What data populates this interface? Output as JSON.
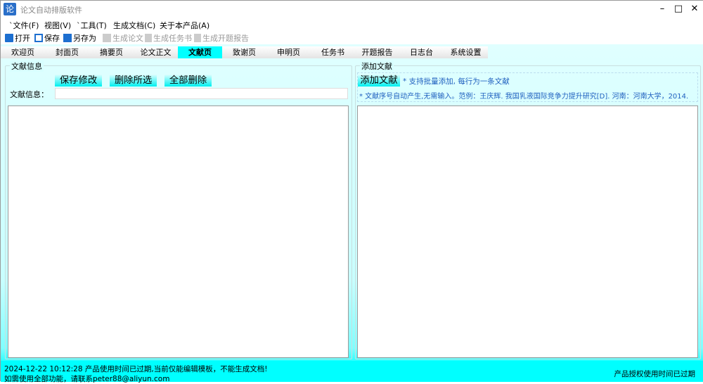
{
  "window": {
    "title": "论文自动排版软件",
    "app_icon": "论"
  },
  "menu": [
    "`文件(F)",
    "视图(V)",
    "`工具(T)",
    "生成文档(C)",
    "关于本产品(A)"
  ],
  "toolbar": [
    {
      "label": "打开",
      "icon": "folder-open-icon",
      "enabled": true
    },
    {
      "label": "保存",
      "icon": "save-icon",
      "enabled": true
    },
    {
      "label": "另存为",
      "icon": "save-as-icon",
      "enabled": true
    },
    {
      "label": "生成论文",
      "icon": "copy-doc-icon",
      "enabled": false
    },
    {
      "label": "生成任务书",
      "icon": "document-icon",
      "enabled": false
    },
    {
      "label": "生成开题报告",
      "icon": "document-icon",
      "enabled": false
    }
  ],
  "tabs": [
    "欢迎页",
    "封面页",
    "摘要页",
    "论文正文",
    "文献页",
    "致谢页",
    "申明页",
    "任务书",
    "开题报告",
    "日志台",
    "系统设置"
  ],
  "active_tab": "文献页",
  "left": {
    "title": "文献信息",
    "save_btn": "保存修改",
    "delete_selected_btn": "删除所选",
    "delete_all_btn": "全部删除",
    "field_label": "文献信息：",
    "field_value": ""
  },
  "right": {
    "title": "添加文献",
    "add_btn": "添加文献",
    "note1": "* 支持批量添加, 每行为一条文献",
    "note2": "* 文献序号自动产生,无需输入。范例：王庆辉. 我国乳液国际竞争力提升研究[D]. 河南：河南大学，2014."
  },
  "status": {
    "line1": "2024-12-22 10:12:28  产品使用时间已过期,当前仅能编辑模板，不能生成文档!",
    "line2": "如需使用全部功能，请联系peter88@aliyun.com",
    "right": "产品授权使用时间已过期"
  },
  "colors": {
    "accent": "#00ffff",
    "note": "#1f5fbf"
  }
}
